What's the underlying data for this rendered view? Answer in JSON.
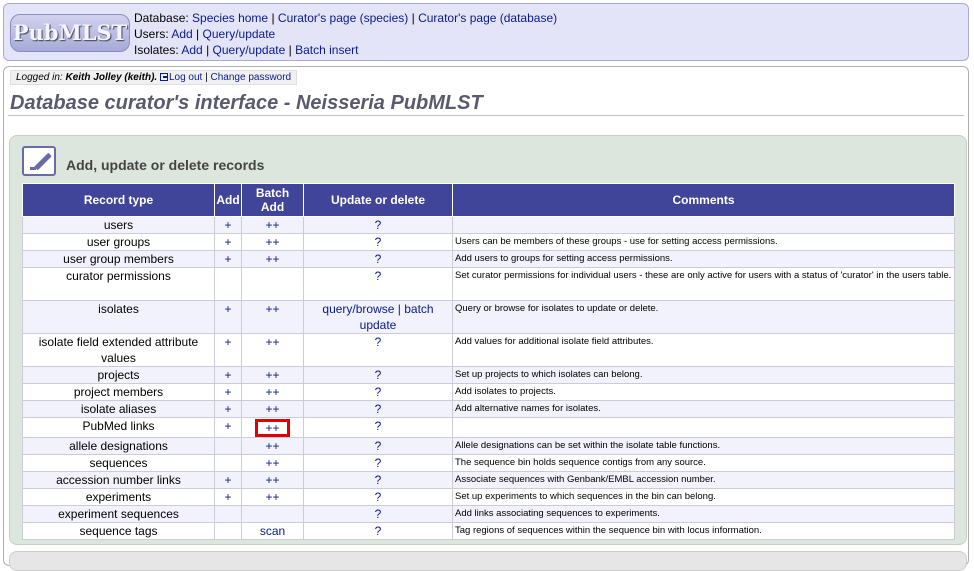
{
  "header": {
    "logo_text": "PubMLST",
    "database_label": "Database:",
    "database_links": [
      "Species home",
      "Curator's page (species)",
      "Curator's page (database)"
    ],
    "users_label": "Users:",
    "users_links": [
      "Add",
      "Query/update"
    ],
    "isolates_label": "Isolates:",
    "isolates_links": [
      "Add",
      "Query/update",
      "Batch insert"
    ]
  },
  "login": {
    "label": "Logged in:",
    "user": "Keith Jolley (keith).",
    "logout": "Log out",
    "change_password": "Change password"
  },
  "page_title": "Database curator's interface - Neisseria PubMLST",
  "box": {
    "heading": "Add, update or delete records",
    "columns": [
      "Record type",
      "Add",
      "Batch Add",
      "Update or delete",
      "Comments"
    ],
    "rows": [
      {
        "type": "users",
        "add": "+",
        "batch": "++",
        "update": "?",
        "comment": ""
      },
      {
        "type": "user groups",
        "add": "+",
        "batch": "++",
        "update": "?",
        "comment": "Users can be members of these groups - use for setting access permissions."
      },
      {
        "type": "user group members",
        "add": "+",
        "batch": "++",
        "update": "?",
        "comment": "Add users to groups for setting access permissions."
      },
      {
        "type": "curator permissions",
        "add": "",
        "batch": "",
        "update": "?",
        "comment": "Set curator permissions for individual users - these are only active for users with a status of 'curator' in the users table."
      },
      {
        "type": "isolates",
        "add": "+",
        "batch": "++",
        "update": "query/browse | batch update",
        "comment": "Query or browse for isolates to update or delete."
      },
      {
        "type": "isolate field extended attribute values",
        "add": "+",
        "batch": "++",
        "update": "?",
        "comment": "Add values for additional isolate field attributes."
      },
      {
        "type": "projects",
        "add": "+",
        "batch": "++",
        "update": "?",
        "comment": "Set up projects to which isolates can belong."
      },
      {
        "type": "project members",
        "add": "+",
        "batch": "++",
        "update": "?",
        "comment": "Add isolates to projects."
      },
      {
        "type": "isolate aliases",
        "add": "+",
        "batch": "++",
        "update": "?",
        "comment": "Add alternative names for isolates."
      },
      {
        "type": "PubMed links",
        "add": "+",
        "batch": "++",
        "update": "?",
        "comment": ""
      },
      {
        "type": "allele designations",
        "add": "",
        "batch": "++",
        "update": "?",
        "comment": "Allele designations can be set within the isolate table functions."
      },
      {
        "type": "sequences",
        "add": "",
        "batch": "++",
        "update": "?",
        "comment": "The sequence bin holds sequence contigs from any source."
      },
      {
        "type": "accession number links",
        "add": "+",
        "batch": "++",
        "update": "?",
        "comment": "Associate sequences with Genbank/EMBL accession number."
      },
      {
        "type": "experiments",
        "add": "+",
        "batch": "++",
        "update": "?",
        "comment": "Set up experiments to which sequences in the bin can belong."
      },
      {
        "type": "experiment sequences",
        "add": "",
        "batch": "",
        "update": "?",
        "comment": "Add links associating sequences to experiments."
      },
      {
        "type": "sequence tags",
        "add": "",
        "batch": "scan",
        "update": "?",
        "comment": "Tag regions of sequences within the sequence bin with locus information."
      }
    ]
  },
  "colors": {
    "table_header": "#414599",
    "box_background": "#dde6dc",
    "highlight": "#e00000",
    "link": "#0a1a8c"
  },
  "highlighted_cell": "PubMed links batch add"
}
